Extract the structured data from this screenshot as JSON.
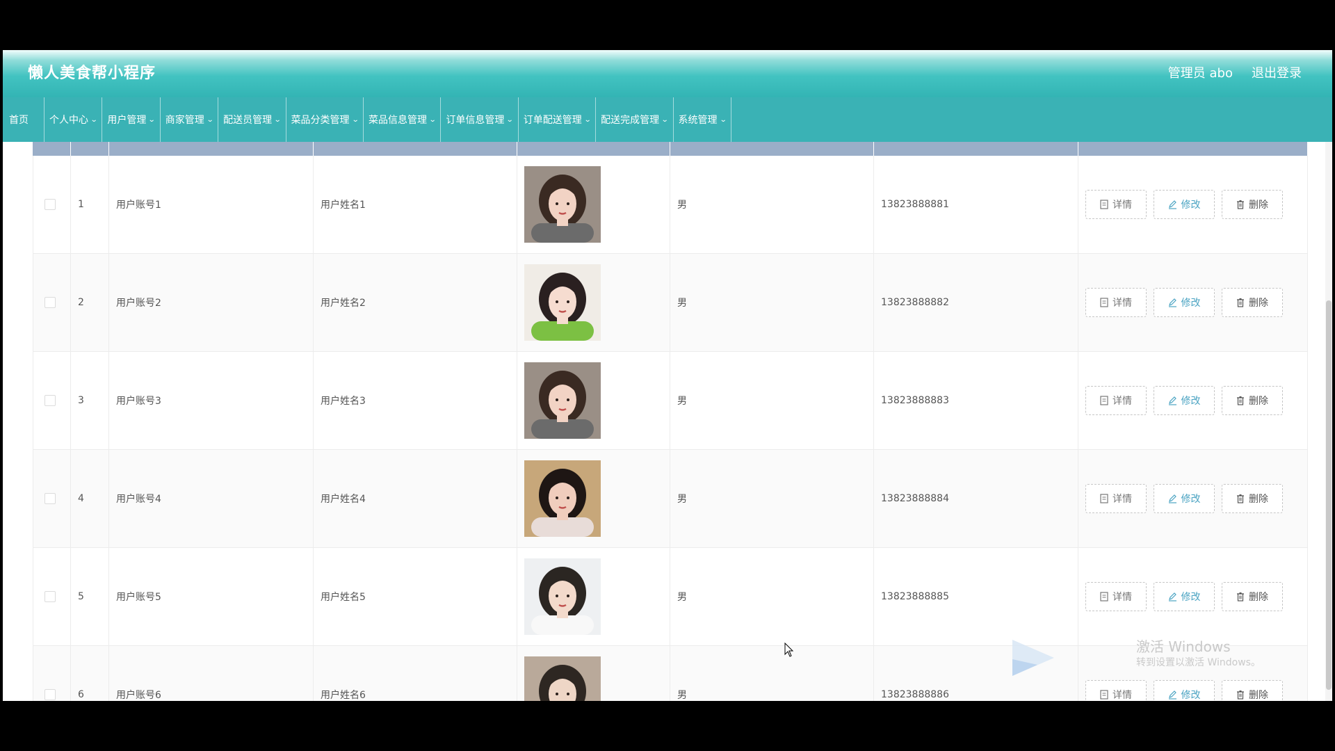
{
  "header": {
    "title": "懒人美食帮小程序",
    "user": "管理员 abo",
    "logout": "退出登录"
  },
  "nav": {
    "items": [
      {
        "label": "首页",
        "dropdown": false
      },
      {
        "label": "个人中心",
        "dropdown": true
      },
      {
        "label": "用户管理",
        "dropdown": true
      },
      {
        "label": "商家管理",
        "dropdown": true
      },
      {
        "label": "配送员管理",
        "dropdown": true
      },
      {
        "label": "菜品分类管理",
        "dropdown": true
      },
      {
        "label": "菜品信息管理",
        "dropdown": true
      },
      {
        "label": "订单信息管理",
        "dropdown": true
      },
      {
        "label": "订单配送管理",
        "dropdown": true
      },
      {
        "label": "配送完成管理",
        "dropdown": true
      },
      {
        "label": "系统管理",
        "dropdown": true
      }
    ]
  },
  "table": {
    "rows": [
      {
        "index": "1",
        "account": "用户账号1",
        "name": "用户姓名1",
        "gender": "男",
        "phone": "13823888881",
        "avatar": "woman-grey-sweater"
      },
      {
        "index": "2",
        "account": "用户账号2",
        "name": "用户姓名2",
        "gender": "男",
        "phone": "13823888882",
        "avatar": "woman-green-sweater"
      },
      {
        "index": "3",
        "account": "用户账号3",
        "name": "用户姓名3",
        "gender": "男",
        "phone": "13823888883",
        "avatar": "woman-grey-sweater"
      },
      {
        "index": "4",
        "account": "用户账号4",
        "name": "用户姓名4",
        "gender": "男",
        "phone": "13823888884",
        "avatar": "woman-outdoor"
      },
      {
        "index": "5",
        "account": "用户账号5",
        "name": "用户姓名5",
        "gender": "男",
        "phone": "13823888885",
        "avatar": "man-white-shirt"
      },
      {
        "index": "6",
        "account": "用户账号6",
        "name": "用户姓名6",
        "gender": "男",
        "phone": "13823888886",
        "avatar": "man-with-dog"
      }
    ],
    "actions": {
      "detail": "详情",
      "edit": "修改",
      "delete": "删除"
    }
  },
  "watermark": {
    "line1": "激活 Windows",
    "line2": "转到设置以激活 Windows。"
  },
  "colors": {
    "nav_bg": "#3ab2b5",
    "header_bg": "#33b4b4",
    "table_head": "#9aaec8",
    "edit_text": "#4aa3c2"
  }
}
